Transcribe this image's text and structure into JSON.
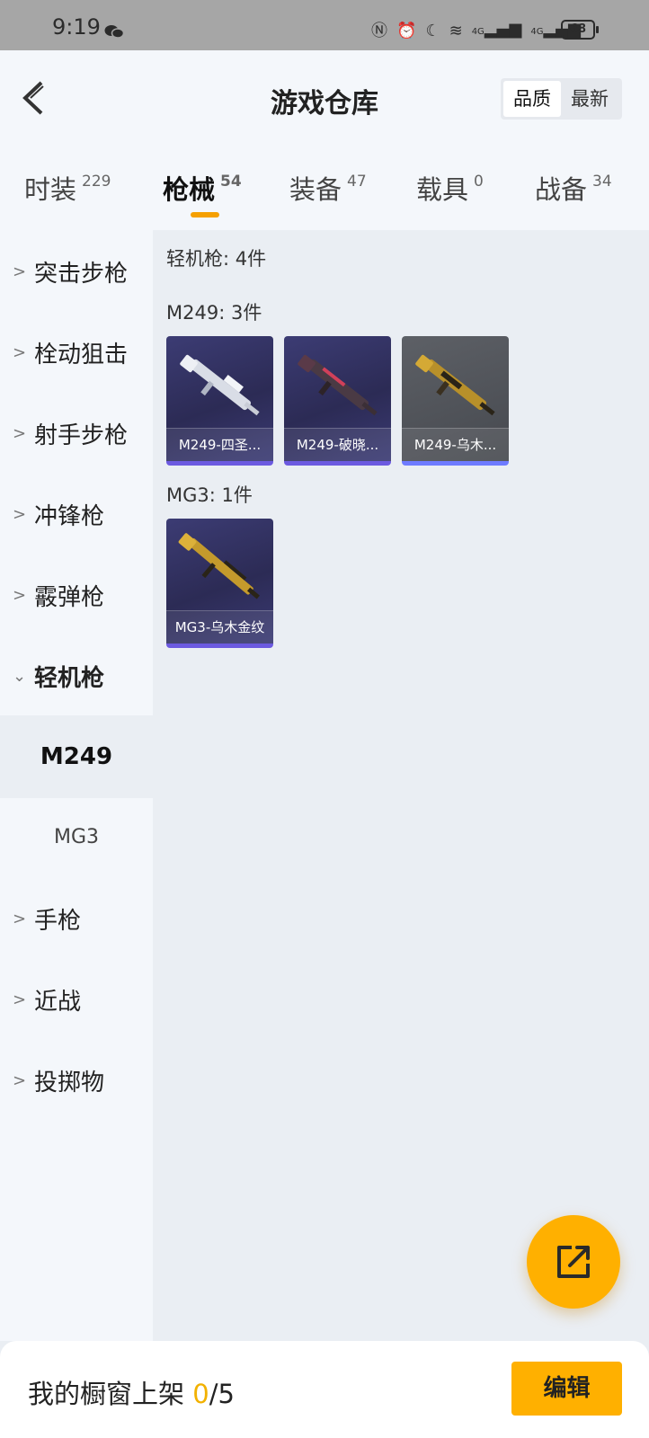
{
  "status_bar": {
    "time": "9:19",
    "battery": "68",
    "net_1": "4G",
    "net_2": "4G"
  },
  "header": {
    "title": "游戏仓库",
    "sort_options": [
      "品质",
      "最新"
    ]
  },
  "tabs": [
    {
      "label": "时装",
      "count": "229"
    },
    {
      "label": "枪械",
      "count": "54"
    },
    {
      "label": "装备",
      "count": "47"
    },
    {
      "label": "载具",
      "count": "0"
    },
    {
      "label": "战备",
      "count": "34"
    }
  ],
  "sidebar": {
    "categories": [
      {
        "label": "突击步枪",
        "chevron": ">"
      },
      {
        "label": "栓动狙击",
        "chevron": ">"
      },
      {
        "label": "射手步枪",
        "chevron": ">"
      },
      {
        "label": "冲锋枪",
        "chevron": ">"
      },
      {
        "label": "霰弹枪",
        "chevron": ">"
      },
      {
        "label": "轻机枪",
        "chevron": "⌄"
      },
      {
        "label": "手枪",
        "chevron": ">"
      },
      {
        "label": "近战",
        "chevron": ">"
      },
      {
        "label": "投掷物",
        "chevron": ">"
      }
    ],
    "subcategories": [
      "M249",
      "MG3"
    ]
  },
  "content": {
    "category_summary": "轻机枪: 4件",
    "groups": [
      {
        "heading": "M249: 3件",
        "items": [
          {
            "label": "M249-四圣...",
            "rarity_color": "#6c5ae0"
          },
          {
            "label": "M249-破晓...",
            "rarity_color": "#6c5ae0"
          },
          {
            "label": "M249-乌木...",
            "rarity_color": "#6e7bff"
          }
        ]
      },
      {
        "heading": "MG3: 1件",
        "items": [
          {
            "label": "MG3-乌木金纹",
            "rarity_color": "#6c5ae0"
          }
        ]
      }
    ]
  },
  "fab_icon": "share-external-icon",
  "bottom_bar": {
    "prefix": "我的橱窗上架",
    "current": "0",
    "separator": "/",
    "total": "5",
    "edit_label": "编辑"
  },
  "colors": {
    "accent": "#ffb000",
    "tab_indicator": "#f5a000",
    "background": "#eaeef3",
    "sidebar": "#f4f7fb"
  }
}
